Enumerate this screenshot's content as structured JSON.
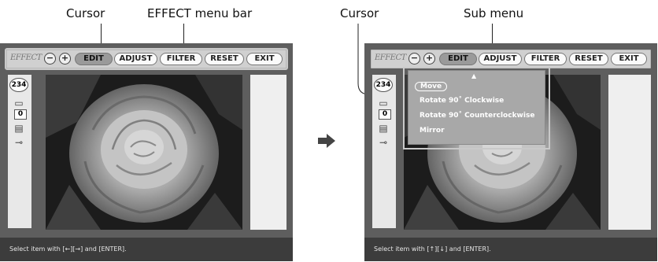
{
  "captions": {
    "left_cursor": "Cursor",
    "effect_menu_bar": "EFFECT menu bar",
    "right_cursor": "Cursor",
    "sub_menu": "Sub menu"
  },
  "menubar": {
    "effect_label": "EFFECT",
    "zoom_out": "−",
    "zoom_in": "+",
    "buttons": [
      "EDIT",
      "ADJUST",
      "FILTER",
      "RESET",
      "EXIT"
    ]
  },
  "sidebar": {
    "counter": "234",
    "copies": "0"
  },
  "submenu": {
    "items": [
      "Move",
      "Rotate 90˚  Clockwise",
      "Rotate 90˚  Counterclockwise",
      "Mirror"
    ],
    "selected": "Move"
  },
  "status": {
    "left": "Select item with [←][→] and [ENTER].",
    "right": "Select item with [↑][↓] and [ENTER]."
  },
  "colors": {
    "screen_bg": "#5e5e5e",
    "menubar_bg": "#d0d0d0",
    "submenu_bg": "#a8a8a8",
    "status_bg": "#3c3c3c"
  }
}
